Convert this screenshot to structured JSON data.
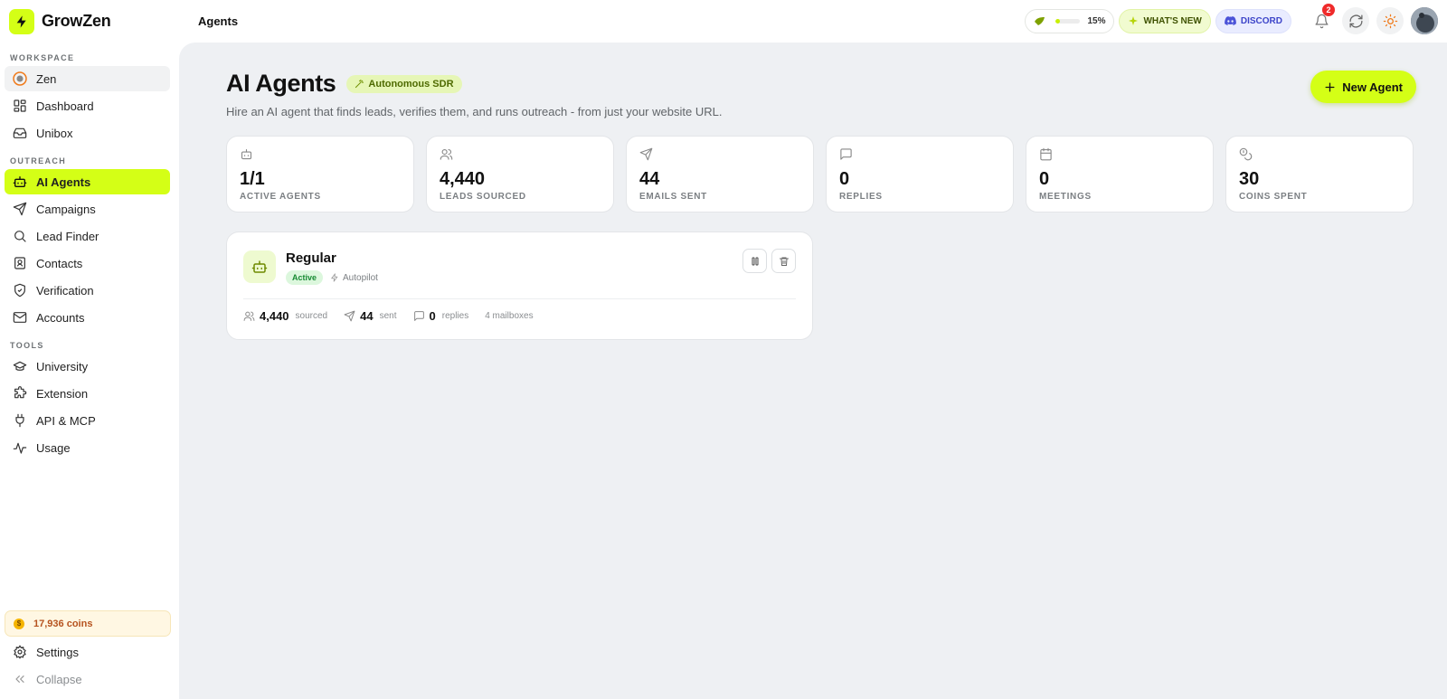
{
  "app": {
    "name": "GrowZen",
    "breadcrumb": "Agents"
  },
  "topbar": {
    "progress_percent": 15,
    "progress_label": "15%",
    "whats_new_label": "WHAT'S NEW",
    "discord_label": "DISCORD",
    "notification_count": "2"
  },
  "sidebar": {
    "sections": {
      "workspace": "WORKSPACE",
      "outreach": "OUTREACH",
      "tools": "TOOLS"
    },
    "workspace_items": [
      {
        "label": "Zen",
        "icon": "target-icon"
      },
      {
        "label": "Dashboard",
        "icon": "dashboard-icon"
      },
      {
        "label": "Unibox",
        "icon": "inbox-icon"
      }
    ],
    "outreach_items": [
      {
        "label": "AI Agents",
        "icon": "robot-icon",
        "active": true
      },
      {
        "label": "Campaigns",
        "icon": "send-icon"
      },
      {
        "label": "Lead Finder",
        "icon": "search-icon"
      },
      {
        "label": "Contacts",
        "icon": "contacts-icon"
      },
      {
        "label": "Verification",
        "icon": "shield-check-icon"
      },
      {
        "label": "Accounts",
        "icon": "mail-icon"
      }
    ],
    "tools_items": [
      {
        "label": "University",
        "icon": "graduation-cap-icon"
      },
      {
        "label": "Extension",
        "icon": "puzzle-icon"
      },
      {
        "label": "API & MCP",
        "icon": "plug-icon"
      },
      {
        "label": "Usage",
        "icon": "activity-icon"
      }
    ],
    "coins_label": "17,936 coins",
    "settings_label": "Settings",
    "collapse_label": "Collapse"
  },
  "main": {
    "title": "AI Agents",
    "tag": "Autonomous SDR",
    "subtitle": "Hire an AI agent that finds leads, verifies them, and runs outreach - from just your website URL.",
    "new_agent_label": "New Agent",
    "stats": [
      {
        "value": "1/1",
        "label": "ACTIVE AGENTS",
        "icon": "robot-icon"
      },
      {
        "value": "4,440",
        "label": "LEADS SOURCED",
        "icon": "users-icon"
      },
      {
        "value": "44",
        "label": "EMAILS SENT",
        "icon": "send-icon"
      },
      {
        "value": "0",
        "label": "REPLIES",
        "icon": "message-icon"
      },
      {
        "value": "0",
        "label": "MEETINGS",
        "icon": "calendar-icon"
      },
      {
        "value": "30",
        "label": "COINS SPENT",
        "icon": "coins-icon"
      }
    ],
    "agent": {
      "name": "Regular",
      "status": "Active",
      "mode": "Autopilot",
      "sourced_value": "4,440",
      "sourced_label": "sourced",
      "sent_value": "44",
      "sent_label": "sent",
      "replies_value": "0",
      "replies_label": "replies",
      "mailboxes": "4 mailboxes"
    }
  },
  "colors": {
    "accent": "#d4ff16",
    "main_bg": "#eef0f3",
    "active_badge": "#dcf7dd",
    "notification": "#ef2b2b"
  }
}
